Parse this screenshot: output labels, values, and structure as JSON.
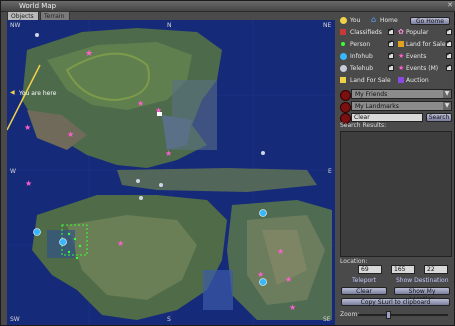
{
  "window": {
    "title": "World Map"
  },
  "tabs": [
    {
      "label": "Objects"
    },
    {
      "label": "Terrain"
    }
  ],
  "map": {
    "compass": {
      "nw": "NW",
      "n": "N",
      "ne": "NE",
      "w": "W",
      "e": "E",
      "sw": "SW",
      "s": "S",
      "se": "SE"
    },
    "you_are_here": "You are here"
  },
  "legend": {
    "you": "You",
    "home": "Home",
    "go_home": "Go Home",
    "classifieds": "Classifieds",
    "popular": "Popular",
    "person": "Person",
    "land_for_sale": "Land for Sale",
    "infohub": "Infohub",
    "events": "Events",
    "telehub": "Telehub",
    "events_m": "Events (M)",
    "land_for_sale_2": "Land For Sale",
    "auction": "Auction"
  },
  "selectors": {
    "friends": "My Friends",
    "landmarks": "My Landmarks",
    "search_value": "Clear",
    "search_button": "Search"
  },
  "search_results_label": "Search Results:",
  "location": {
    "label": "Location:",
    "x": "69",
    "y": "165",
    "z": "22",
    "teleport": "Teleport",
    "show_destination": "Show Destination",
    "clear": "Clear",
    "show_my_location": "Show My Location",
    "copy_slurl": "Copy SLurl to clipboard"
  },
  "zoom_label": "Zoom:",
  "colors": {
    "accent": "#7b7fa0",
    "map_water": "#162a7a",
    "event": "#ff5fd0"
  }
}
